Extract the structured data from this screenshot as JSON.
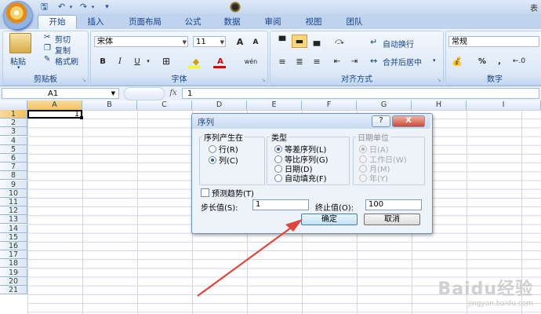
{
  "titlebar": {
    "title_fragment": "表"
  },
  "tabs": [
    "开始",
    "插入",
    "页面布局",
    "公式",
    "数据",
    "审阅",
    "视图",
    "团队"
  ],
  "ribbon": {
    "clipboard": {
      "paste": "粘贴",
      "cut": "剪切",
      "copy": "复制",
      "format_painter": "格式刷",
      "label": "剪贴板"
    },
    "font": {
      "name": "宋体",
      "size": "11",
      "grow": "A",
      "shrink": "A",
      "bold": "B",
      "italic": "I",
      "underline": "U",
      "font_color_letter": "A",
      "phonetic": "wén",
      "label": "字体"
    },
    "alignment": {
      "wrap_text": "自动换行",
      "merge_center": "合并后居中",
      "label": "对齐方式"
    },
    "number": {
      "format": "常规",
      "percent": "%",
      "comma": ",",
      "label": "数字"
    }
  },
  "formula_bar": {
    "name_box": "A1",
    "fx": "fx",
    "content": "1"
  },
  "columns": [
    "A",
    "B",
    "C",
    "D",
    "E",
    "F",
    "G",
    "H",
    "I"
  ],
  "rows": [
    "1",
    "2",
    "3",
    "4",
    "5",
    "6",
    "7",
    "8",
    "9",
    "10",
    "11",
    "12",
    "13",
    "14",
    "15",
    "16",
    "17",
    "18",
    "19",
    "20",
    "21"
  ],
  "cell_a1": "1",
  "dialog": {
    "title": "序列",
    "help": "?",
    "close": "X",
    "series_in": {
      "legend": "序列产生在",
      "options": [
        "行(R)",
        "列(C)"
      ],
      "selected": 1
    },
    "type": {
      "legend": "类型",
      "options": [
        "等差序列(L)",
        "等比序列(G)",
        "日期(D)",
        "自动填充(F)"
      ],
      "selected": 0
    },
    "date_unit": {
      "legend": "日期单位",
      "options": [
        "日(A)",
        "工作日(W)",
        "月(M)",
        "年(Y)"
      ],
      "selected": 0
    },
    "trend": "预测趋势(T)",
    "step_label": "步长值(S):",
    "step_value": "1",
    "stop_label": "终止值(O):",
    "stop_value": "100",
    "ok": "确定",
    "cancel": "取消"
  },
  "watermark": {
    "main": "Baidu经验",
    "sub": "jingyan.baidu.com"
  },
  "colors": {
    "accent": "#15428b",
    "arrow": "#e0453a"
  }
}
